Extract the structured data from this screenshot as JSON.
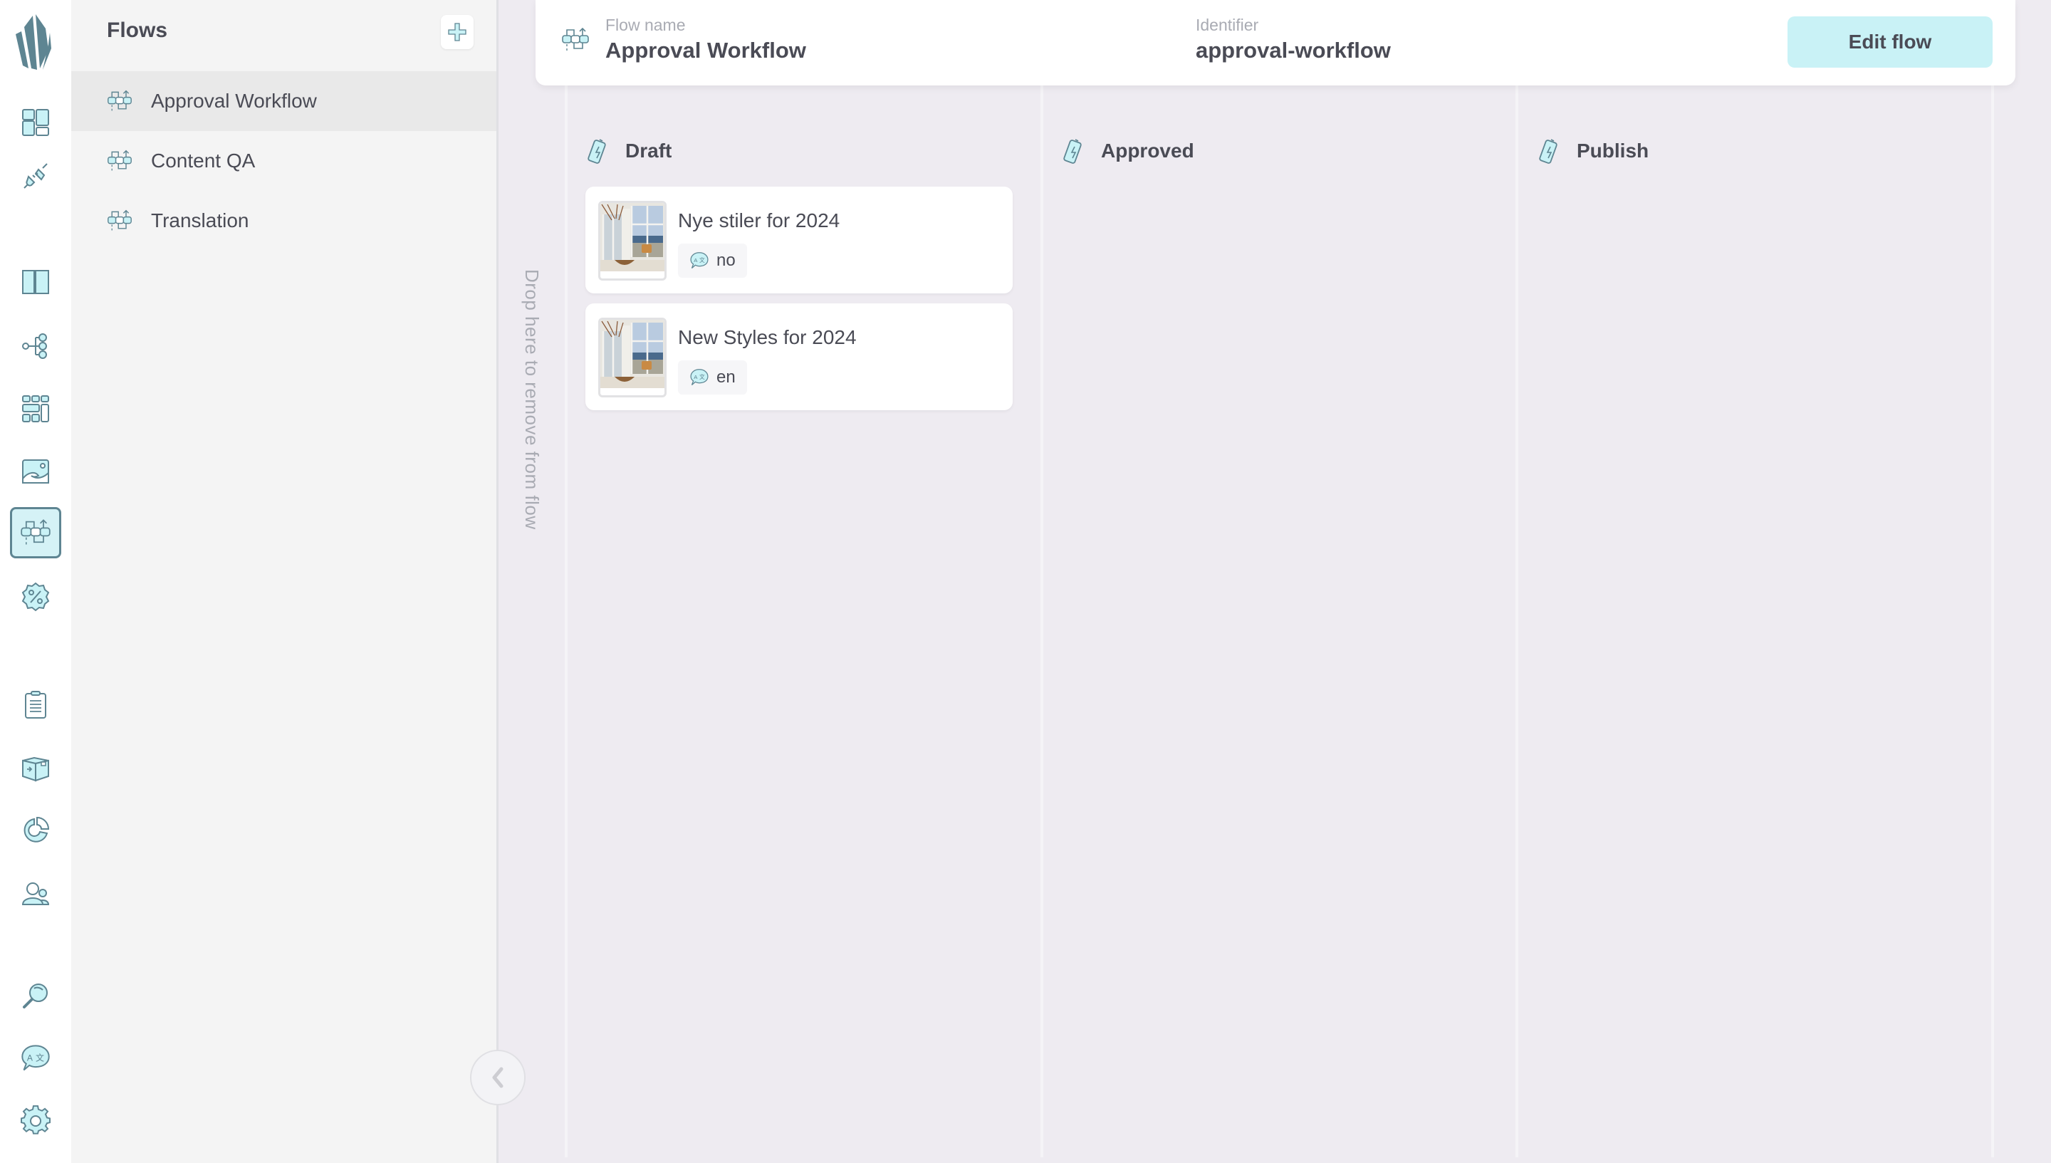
{
  "rail": {
    "items": [
      {
        "name": "dashboard",
        "icon": "dashboard-icon"
      },
      {
        "name": "integrations",
        "icon": "plug-icon"
      },
      {
        "name": "catalogs",
        "icon": "book-icon"
      },
      {
        "name": "hierarchy",
        "icon": "tree-icon"
      },
      {
        "name": "grid",
        "icon": "grid-icon"
      },
      {
        "name": "media",
        "icon": "image-icon"
      },
      {
        "name": "flows",
        "icon": "flow-icon",
        "active": true
      },
      {
        "name": "discounts",
        "icon": "discount-icon"
      },
      {
        "name": "orders",
        "icon": "clipboard-icon"
      },
      {
        "name": "shipping",
        "icon": "box-icon"
      },
      {
        "name": "reports",
        "icon": "pie-chart-icon"
      },
      {
        "name": "customers",
        "icon": "users-icon"
      },
      {
        "name": "search",
        "icon": "search-icon"
      },
      {
        "name": "translations",
        "icon": "translate-icon"
      },
      {
        "name": "settings",
        "icon": "gear-icon"
      }
    ]
  },
  "sidebar": {
    "title": "Flows",
    "add_label": "+",
    "items": [
      {
        "label": "Approval Workflow",
        "selected": true
      },
      {
        "label": "Content QA",
        "selected": false
      },
      {
        "label": "Translation",
        "selected": false
      }
    ]
  },
  "header": {
    "flow_name_label": "Flow name",
    "flow_name": "Approval Workflow",
    "identifier_label": "Identifier",
    "identifier": "approval-workflow",
    "edit_button": "Edit flow"
  },
  "dropzone": {
    "text": "Drop here to remove from flow"
  },
  "columns": [
    {
      "title": "Draft",
      "cards": [
        {
          "title": "Nye stiler for 2024",
          "language": "no"
        },
        {
          "title": "New Styles for 2024",
          "language": "en"
        }
      ]
    },
    {
      "title": "Approved",
      "cards": []
    },
    {
      "title": "Publish",
      "cards": []
    }
  ],
  "colors": {
    "accent": "#c9f2f6",
    "icon_stroke": "#5e8592",
    "text": "#4a4b55",
    "muted": "#a9abb3",
    "board_bg": "#eeebf1"
  }
}
